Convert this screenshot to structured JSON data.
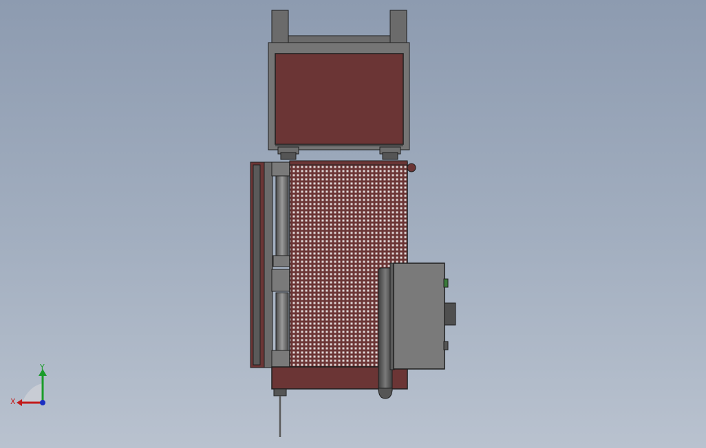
{
  "viewport": {
    "background_top": "#8d9bb0",
    "background_bottom": "#b9c2cf"
  },
  "model": {
    "frame_color": "#6b6b6b",
    "panel_color": "#6b3535",
    "edge_color": "#1e1e1e",
    "control_box_color": "#7a7a7a"
  },
  "triad": {
    "x_label": "X",
    "y_label": "Y",
    "x_color": "#c21a1a",
    "y_color": "#1a9c2a",
    "z_color": "#1a2fc2"
  }
}
